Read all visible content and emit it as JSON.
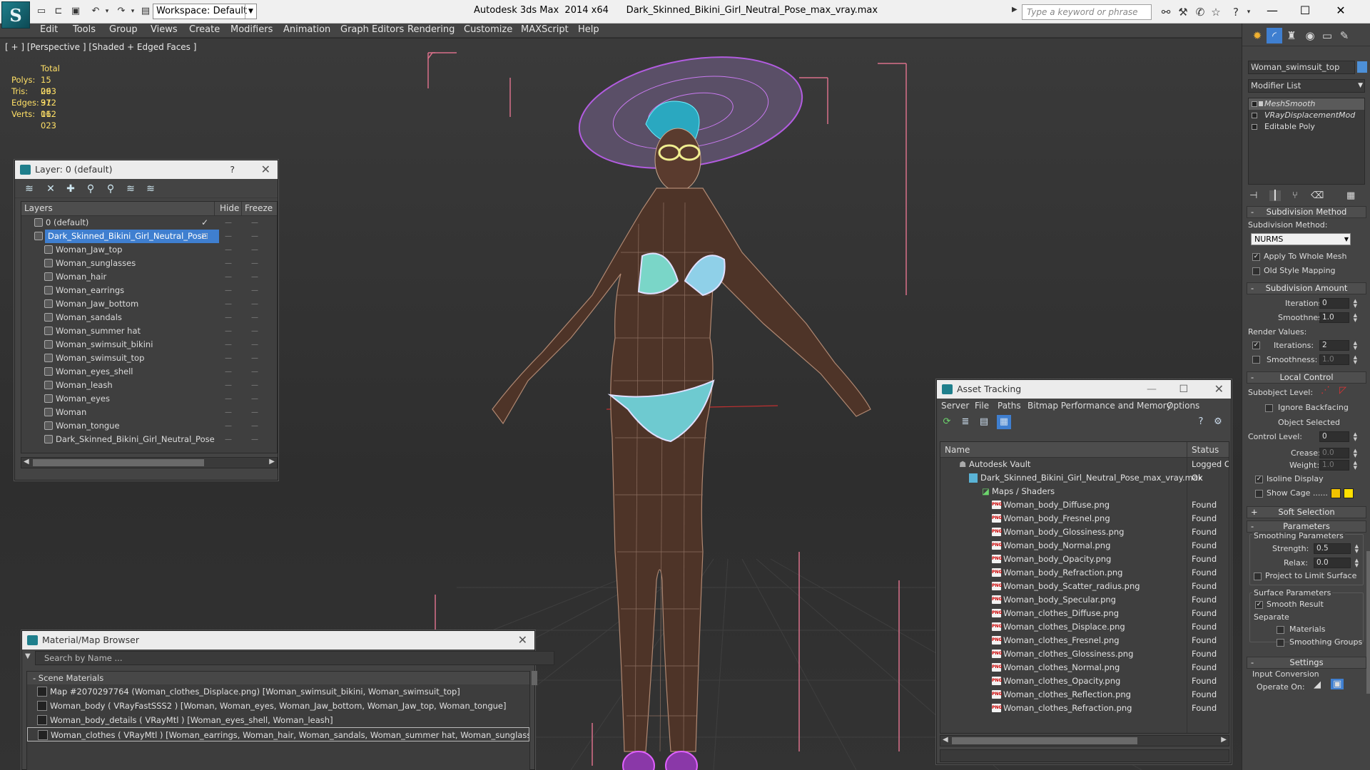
{
  "titlebar": {
    "logo_letter": "S",
    "workspace": "Workspace: Default",
    "title": "Autodesk 3ds Max  2014 x64      Dark_Skinned_Bikini_Girl_Neutral_Pose_max_vray.max",
    "search_placeholder": "Type a keyword or phrase"
  },
  "menu": [
    "Edit",
    "Tools",
    "Group",
    "Views",
    "Create",
    "Modifiers",
    "Animation",
    "Graph Editors",
    "Rendering",
    "Customize",
    "MAXScript",
    "Help"
  ],
  "viewport": {
    "label": "[ + ] [Perspective ] [Shaded + Edged Faces ]",
    "stats": {
      "header": "Total",
      "rows": [
        {
          "k": "Polys:",
          "v": "15 063"
        },
        {
          "k": "Tris:",
          "v": "29 972"
        },
        {
          "k": "Edges:",
          "v": "31 012"
        },
        {
          "k": "Verts:",
          "v": "16 023"
        }
      ]
    }
  },
  "layer_window": {
    "title": "Layer: 0 (default)",
    "help": "?",
    "close": "✕",
    "col_layers": "Layers",
    "col_hide": "Hide",
    "col_freeze": "Freeze",
    "root_layer": "0 (default)",
    "active_layer": "Dark_Skinned_Bikini_Girl_Neutral_Pose",
    "objects": [
      "Woman_Jaw_top",
      "Woman_sunglasses",
      "Woman_hair",
      "Woman_earrings",
      "Woman_Jaw_bottom",
      "Woman_sandals",
      "Woman_summer hat",
      "Woman_swimsuit_bikini",
      "Woman_swimsuit_top",
      "Woman_eyes_shell",
      "Woman_leash",
      "Woman_eyes",
      "Woman",
      "Woman_tongue",
      "Dark_Skinned_Bikini_Girl_Neutral_Pose"
    ]
  },
  "material_browser": {
    "title": "Material/Map Browser",
    "close": "✕",
    "search_placeholder": "Search by Name ...",
    "section": "- Scene Materials",
    "items": [
      "Map #2070297764 (Woman_clothes_Displace.png) [Woman_swimsuit_bikini, Woman_swimsuit_top]",
      "Woman_body  ( VRayFastSSS2 ) [Woman, Woman_eyes, Woman_Jaw_bottom, Woman_Jaw_top, Woman_tongue]",
      "Woman_body_details  ( VRayMtl ) [Woman_eyes_shell, Woman_leash]",
      "Woman_clothes  ( VRayMtl ) [Woman_earrings, Woman_hair, Woman_sandals, Woman_summer hat, Woman_sunglasses, Wom..."
    ]
  },
  "asset_tracking": {
    "title": "Asset Tracking",
    "menu": [
      "Server",
      "File",
      "Paths",
      "Bitmap Performance and Memory",
      "Options"
    ],
    "col_name": "Name",
    "col_status": "Status",
    "vault": {
      "name": "Autodesk Vault",
      "status": "Logged O"
    },
    "file": {
      "name": "Dark_Skinned_Bikini_Girl_Neutral_Pose_max_vray.max",
      "status": "Ok"
    },
    "maps_group": "Maps / Shaders",
    "maps": [
      {
        "name": "Woman_body_Diffuse.png",
        "status": "Found"
      },
      {
        "name": "Woman_body_Fresnel.png",
        "status": "Found"
      },
      {
        "name": "Woman_body_Glossiness.png",
        "status": "Found"
      },
      {
        "name": "Woman_body_Normal.png",
        "status": "Found"
      },
      {
        "name": "Woman_body_Opacity.png",
        "status": "Found"
      },
      {
        "name": "Woman_body_Refraction.png",
        "status": "Found"
      },
      {
        "name": "Woman_body_Scatter_radius.png",
        "status": "Found"
      },
      {
        "name": "Woman_body_Specular.png",
        "status": "Found"
      },
      {
        "name": "Woman_clothes_Diffuse.png",
        "status": "Found"
      },
      {
        "name": "Woman_clothes_Displace.png",
        "status": "Found"
      },
      {
        "name": "Woman_clothes_Fresnel.png",
        "status": "Found"
      },
      {
        "name": "Woman_clothes_Glossiness.png",
        "status": "Found"
      },
      {
        "name": "Woman_clothes_Normal.png",
        "status": "Found"
      },
      {
        "name": "Woman_clothes_Opacity.png",
        "status": "Found"
      },
      {
        "name": "Woman_clothes_Reflection.png",
        "status": "Found"
      },
      {
        "name": "Woman_clothes_Refraction.png",
        "status": "Found"
      }
    ]
  },
  "command_panel": {
    "object_name": "Woman_swimsuit_top",
    "modifier_list": "Modifier List",
    "stack": [
      "MeshSmooth",
      "VRayDisplacementMod",
      "Editable Poly"
    ],
    "subdivision_method": {
      "rollout": "Subdivision Method",
      "label": "Subdivision Method:",
      "value": "NURMS",
      "apply_whole_mesh": "Apply To Whole Mesh",
      "old_style": "Old Style Mapping"
    },
    "subdivision_amount": {
      "rollout": "Subdivision Amount",
      "iterations_label": "Iterations:",
      "iterations": "0",
      "smoothness_label": "Smoothness:",
      "smoothness": "1.0",
      "render_values": "Render Values:",
      "r_iterations_label": "Iterations:",
      "r_iterations": "2",
      "r_smoothness_label": "Smoothness:",
      "r_smoothness": "1.0"
    },
    "local_control": {
      "rollout": "Local Control",
      "subobject_label": "Subobject Level:",
      "ignore_backfacing": "Ignore Backfacing",
      "object_selected": "Object Selected",
      "control_level_label": "Control Level:",
      "control_level": "0",
      "crease_label": "Crease:",
      "crease": "0.0",
      "weight_label": "Weight:",
      "weight": "1.0",
      "isoline": "Isoline Display",
      "show_cage": "Show Cage ......"
    },
    "soft_selection": {
      "rollout": "Soft Selection"
    },
    "parameters": {
      "rollout": "Parameters",
      "smoothing_params": "Smoothing Parameters",
      "strength_label": "Strength:",
      "strength": "0.5",
      "relax_label": "Relax:",
      "relax": "0.0",
      "project": "Project to Limit Surface",
      "surface_params": "Surface Parameters",
      "smooth_result": "Smooth Result",
      "separate": "Separate",
      "materials": "Materials",
      "smoothing_groups": "Smoothing Groups"
    },
    "settings": {
      "rollout": "Settings",
      "input_conversion": "Input Conversion",
      "operate_on": "Operate On:"
    },
    "cage_colors": [
      "#f2c200",
      "#ffe000"
    ]
  }
}
